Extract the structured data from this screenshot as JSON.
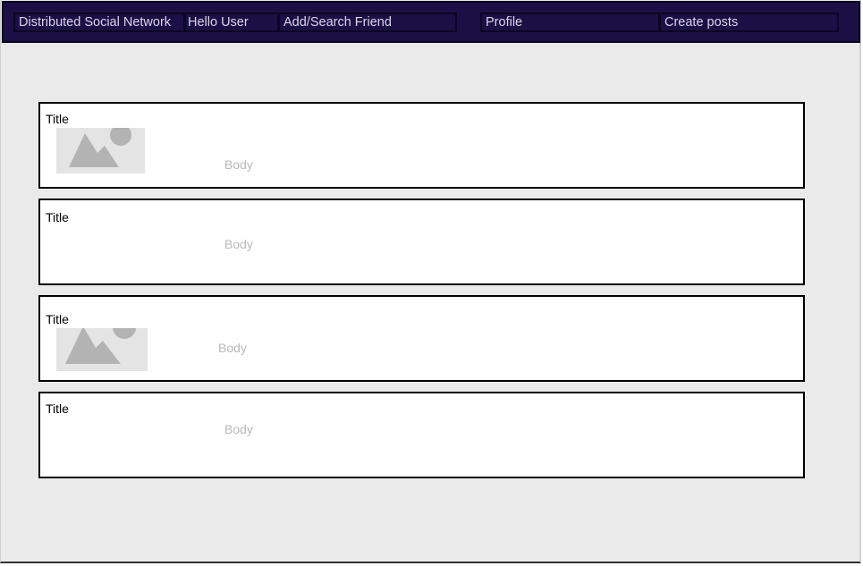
{
  "navbar": {
    "brand": "Distributed Social Network",
    "greeting": "Hello User",
    "search_link": "Add/Search Friend",
    "profile_link": "Profile",
    "create_link": "Create posts"
  },
  "posts": [
    {
      "title": "Title",
      "body": "Body",
      "has_image": true,
      "image_icon": "image-placeholder-icon"
    },
    {
      "title": "Title",
      "body": "Body",
      "has_image": false
    },
    {
      "title": "Title",
      "body": "Body",
      "has_image": true,
      "image_icon": "image-placeholder-icon"
    },
    {
      "title": "Title",
      "body": "Body",
      "has_image": false
    }
  ],
  "colors": {
    "navbar_bg": "#1b0f45",
    "page_bg": "#eaeaea",
    "card_border": "#000000",
    "placeholder_text": "#b9b9b9"
  }
}
